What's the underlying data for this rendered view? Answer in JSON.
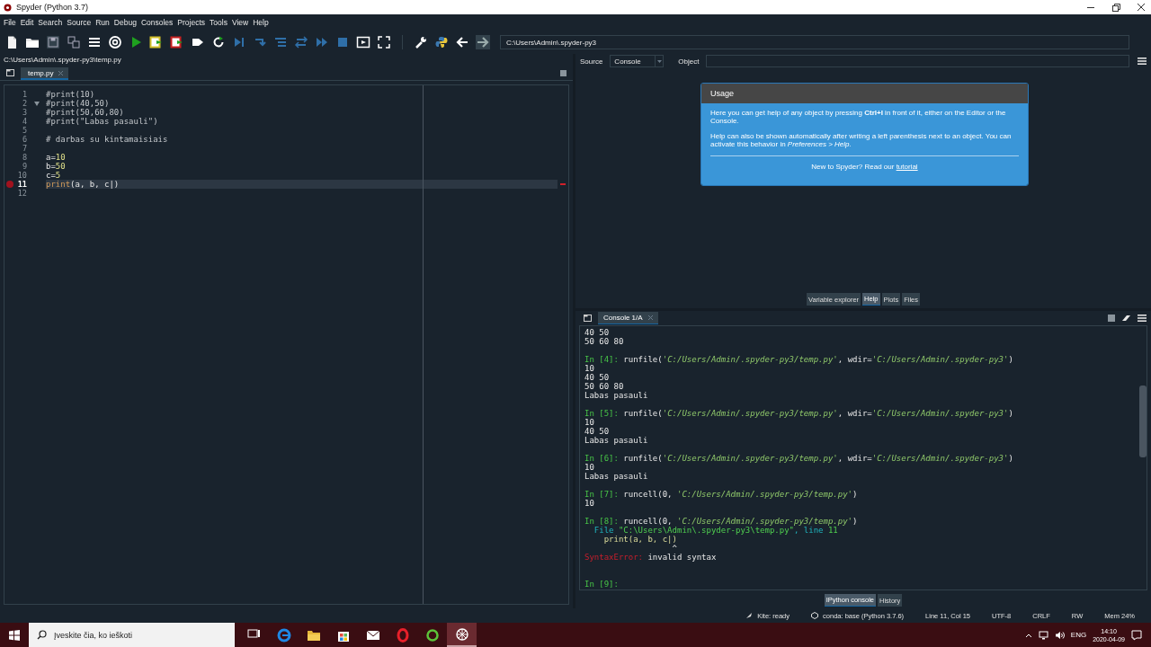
{
  "window": {
    "title": "Spyder (Python 3.7)"
  },
  "menu": [
    "File",
    "Edit",
    "Search",
    "Source",
    "Run",
    "Debug",
    "Consoles",
    "Projects",
    "Tools",
    "View",
    "Help"
  ],
  "toolbar": {
    "working_directory": "C:\\Users\\Admin\\.spyder-py3"
  },
  "editor": {
    "file_path": "C:\\Users\\Admin\\.spyder-py3\\temp.py",
    "tabs": [
      {
        "label": "temp.py",
        "selected": true
      }
    ],
    "lines": [
      {
        "number": "1",
        "breakpoint": false,
        "current": false,
        "foldable": false,
        "tokens": [
          {
            "kind": "comment",
            "text": "#print(10)"
          }
        ]
      },
      {
        "number": "2",
        "breakpoint": false,
        "current": false,
        "foldable": true,
        "tokens": [
          {
            "kind": "comment",
            "text": "#print(40,50)"
          }
        ]
      },
      {
        "number": "3",
        "breakpoint": false,
        "current": false,
        "foldable": false,
        "tokens": [
          {
            "kind": "comment",
            "text": "#print(50,60,80)"
          }
        ]
      },
      {
        "number": "4",
        "breakpoint": false,
        "current": false,
        "foldable": false,
        "tokens": [
          {
            "kind": "comment",
            "text": "#print(\"Labas pasauli\")"
          }
        ]
      },
      {
        "number": "5",
        "breakpoint": false,
        "current": false,
        "foldable": false
      },
      {
        "number": "6",
        "breakpoint": false,
        "current": false,
        "foldable": false,
        "tokens": [
          {
            "kind": "comment",
            "text": "# darbas su kintamaisiais"
          }
        ]
      },
      {
        "number": "7",
        "breakpoint": false,
        "current": false,
        "foldable": false
      },
      {
        "number": "8",
        "breakpoint": false,
        "current": false,
        "foldable": false,
        "tokens": [
          {
            "kind": "plain",
            "text": "a="
          },
          {
            "kind": "number",
            "text": "10"
          }
        ]
      },
      {
        "number": "9",
        "breakpoint": false,
        "current": false,
        "foldable": false,
        "tokens": [
          {
            "kind": "plain",
            "text": "b="
          },
          {
            "kind": "number",
            "text": "50"
          }
        ]
      },
      {
        "number": "10",
        "breakpoint": false,
        "current": false,
        "foldable": false,
        "tokens": [
          {
            "kind": "plain",
            "text": "c="
          },
          {
            "kind": "number",
            "text": "5"
          }
        ]
      },
      {
        "number": "11",
        "breakpoint": true,
        "current": true,
        "foldable": false,
        "tokens": [
          {
            "kind": "builtin",
            "text": "print"
          },
          {
            "kind": "plain",
            "text": "(a, b, c|)"
          }
        ]
      },
      {
        "number": "12",
        "breakpoint": false,
        "current": false,
        "foldable": false
      }
    ]
  },
  "help": {
    "source_label": "Source",
    "source_value": "Console",
    "object_label": "Object",
    "usage": {
      "title": "Usage",
      "paragraphs": [
        "Here you can get help of any object by pressing **Ctrl+I** in front of it, either on the Editor or the Console.",
        "Help can also be shown automatically after writing a left parenthesis next to an object. You can activate this behavior in *Preferences > Help*."
      ],
      "footer": "New to Spyder? Read our",
      "link": "tutorial"
    },
    "tabs": [
      {
        "label": "Variable explorer",
        "selected": false
      },
      {
        "label": "Help",
        "selected": true
      },
      {
        "label": "Plots",
        "selected": false
      },
      {
        "label": "Files",
        "selected": false
      }
    ]
  },
  "console": {
    "tabs": [
      {
        "label": "Console 1/A",
        "selected": true
      }
    ],
    "lines": [
      {
        "kind": "text",
        "tokens": [
          {
            "kind": "plain",
            "text": "40 50"
          }
        ]
      },
      {
        "kind": "text",
        "tokens": [
          {
            "kind": "plain",
            "text": "50 60 80"
          }
        ]
      },
      {
        "kind": "blank"
      },
      {
        "kind": "text",
        "tokens": [
          {
            "kind": "prompt",
            "text": "In [4]:"
          },
          {
            "kind": "plain",
            "text": " runfile("
          },
          {
            "kind": "string",
            "text": "'C:/Users/Admin/.spyder-py3/temp.py'"
          },
          {
            "kind": "plain",
            "text": ", wdir="
          },
          {
            "kind": "string",
            "text": "'C:/Users/Admin/.spyder-py3'"
          },
          {
            "kind": "plain",
            "text": ")"
          }
        ]
      },
      {
        "kind": "text",
        "tokens": [
          {
            "kind": "plain",
            "text": "10"
          }
        ]
      },
      {
        "kind": "text",
        "tokens": [
          {
            "kind": "plain",
            "text": "40 50"
          }
        ]
      },
      {
        "kind": "text",
        "tokens": [
          {
            "kind": "plain",
            "text": "50 60 80"
          }
        ]
      },
      {
        "kind": "text",
        "tokens": [
          {
            "kind": "plain",
            "text": "Labas pasauli"
          }
        ]
      },
      {
        "kind": "blank"
      },
      {
        "kind": "text",
        "tokens": [
          {
            "kind": "prompt",
            "text": "In [5]:"
          },
          {
            "kind": "plain",
            "text": " runfile("
          },
          {
            "kind": "string",
            "text": "'C:/Users/Admin/.spyder-py3/temp.py'"
          },
          {
            "kind": "plain",
            "text": ", wdir="
          },
          {
            "kind": "string",
            "text": "'C:/Users/Admin/.spyder-py3'"
          },
          {
            "kind": "plain",
            "text": ")"
          }
        ]
      },
      {
        "kind": "text",
        "tokens": [
          {
            "kind": "plain",
            "text": "10"
          }
        ]
      },
      {
        "kind": "text",
        "tokens": [
          {
            "kind": "plain",
            "text": "40 50"
          }
        ]
      },
      {
        "kind": "text",
        "tokens": [
          {
            "kind": "plain",
            "text": "Labas pasauli"
          }
        ]
      },
      {
        "kind": "blank"
      },
      {
        "kind": "text",
        "tokens": [
          {
            "kind": "prompt",
            "text": "In [6]:"
          },
          {
            "kind": "plain",
            "text": " runfile("
          },
          {
            "kind": "string",
            "text": "'C:/Users/Admin/.spyder-py3/temp.py'"
          },
          {
            "kind": "plain",
            "text": ", wdir="
          },
          {
            "kind": "string",
            "text": "'C:/Users/Admin/.spyder-py3'"
          },
          {
            "kind": "plain",
            "text": ")"
          }
        ]
      },
      {
        "kind": "text",
        "tokens": [
          {
            "kind": "plain",
            "text": "10"
          }
        ]
      },
      {
        "kind": "text",
        "tokens": [
          {
            "kind": "plain",
            "text": "Labas pasauli"
          }
        ]
      },
      {
        "kind": "blank"
      },
      {
        "kind": "text",
        "tokens": [
          {
            "kind": "prompt",
            "text": "In [7]:"
          },
          {
            "kind": "plain",
            "text": " runcell(0, "
          },
          {
            "kind": "string",
            "text": "'C:/Users/Admin/.spyder-py3/temp.py'"
          },
          {
            "kind": "plain",
            "text": ")"
          }
        ]
      },
      {
        "kind": "text",
        "tokens": [
          {
            "kind": "plain",
            "text": "10"
          }
        ]
      },
      {
        "kind": "blank"
      },
      {
        "kind": "text",
        "tokens": [
          {
            "kind": "prompt",
            "text": "In [8]:"
          },
          {
            "kind": "plain",
            "text": " runcell(0, "
          },
          {
            "kind": "string",
            "text": "'C:/Users/Admin/.spyder-py3/temp.py'"
          },
          {
            "kind": "plain",
            "text": ")"
          }
        ]
      },
      {
        "kind": "text",
        "tokens": [
          {
            "kind": "trace",
            "text": "  File "
          },
          {
            "kind": "trace_value",
            "text": "\"C:\\Users\\Admin\\.spyder-py3\\temp.py\""
          },
          {
            "kind": "trace",
            "text": ", line "
          },
          {
            "kind": "trace_value",
            "text": "11"
          }
        ]
      },
      {
        "kind": "text",
        "tokens": [
          {
            "kind": "source",
            "text": "    print(a, b, c|)"
          }
        ]
      },
      {
        "kind": "text",
        "tokens": [
          {
            "kind": "plain",
            "text": "                  ^"
          }
        ]
      },
      {
        "kind": "text",
        "tokens": [
          {
            "kind": "error",
            "text": "SyntaxError:"
          },
          {
            "kind": "plain",
            "text": " invalid syntax"
          }
        ]
      },
      {
        "kind": "blank"
      },
      {
        "kind": "blank"
      },
      {
        "kind": "text",
        "tokens": [
          {
            "kind": "prompt",
            "text": "In [9]:"
          }
        ]
      }
    ],
    "bottom_tabs": [
      {
        "label": "IPython console",
        "selected": true
      },
      {
        "label": "History",
        "selected": false
      }
    ]
  },
  "status_bar": [
    {
      "kind": "kite",
      "text": "Kite: ready"
    },
    {
      "kind": "conda",
      "text": "conda: base (Python 3.7.6)"
    },
    {
      "kind": "plain",
      "text": "Line 11, Col 15"
    },
    {
      "kind": "plain",
      "text": "UTF-8"
    },
    {
      "kind": "plain",
      "text": "CRLF"
    },
    {
      "kind": "plain",
      "text": "RW"
    },
    {
      "kind": "plain",
      "text": "Mem 24%"
    }
  ],
  "taskbar": {
    "search_placeholder": "Įveskite čia, ko ieškoti",
    "language": "ENG",
    "time": "14:10",
    "date": "2020-04-09"
  }
}
